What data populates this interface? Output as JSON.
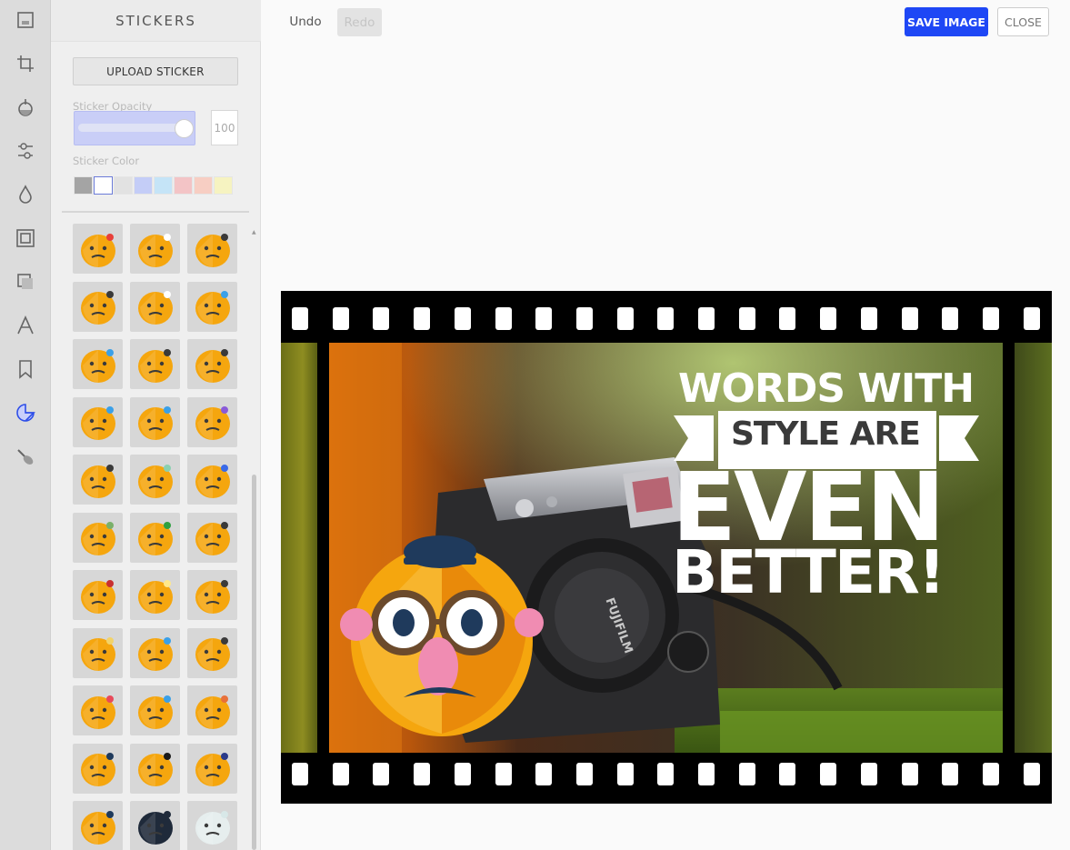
{
  "panel": {
    "title": "STICKERS",
    "upload_label": "UPLOAD STICKER",
    "opacity_label": "Sticker Opacity",
    "opacity_value": "100",
    "opacity_fraction": 1.0,
    "color_label": "Sticker Color",
    "swatches": [
      "#a4a4a4",
      "#ffffff",
      "#e2e2e2",
      "#c4cdf7",
      "#c5e4f7",
      "#f3c4c6",
      "#f7cec3",
      "#f6f3c1"
    ],
    "selected_swatch": 1,
    "stickers": [
      "angry-steam-face",
      "crying-face",
      "frowning-face",
      "pouting-face",
      "tear-squint-face",
      "loudly-crying-face",
      "sobbing-face",
      "expressionless-face",
      "unamused-face",
      "cold-sweat-face",
      "sad-tear-face",
      "sleeping-face",
      "dizzy-face",
      "thinking-face",
      "confused-face",
      "nauseated-face",
      "vomiting-face",
      "grimacing-face",
      "boxing-face",
      "idea-face",
      "blowing-face",
      "beer-face",
      "skateboard-face",
      "guitar-face",
      "headphones-face",
      "swimsuit-face",
      "flower-face",
      "glasses-mustache-face",
      "sunglasses-face",
      "elvis-face",
      "businessman-face",
      "cat-mask-face",
      "skull-face"
    ]
  },
  "toolbar": {
    "undo_label": "Undo",
    "redo_label": "Redo",
    "save_label": "SAVE IMAGE",
    "close_label": "CLOSE"
  },
  "rail": {
    "tools": [
      "frame-icon",
      "crop-icon",
      "filter-icon",
      "adjust-icon",
      "blur-icon",
      "frame-border-icon",
      "shape-icon",
      "text-icon",
      "bookmark-icon",
      "sticker-icon",
      "brush-icon"
    ],
    "active_tool": "sticker-icon"
  },
  "canvas": {
    "overlay_lines": [
      "WORDS WITH",
      "STYLE ARE",
      "EVEN",
      "BETTER!"
    ],
    "camera_brand": "FUJIFILM",
    "colors": {
      "accent": "#1e47f5",
      "sticker_orange": "#f5a60e",
      "film": "#000000"
    }
  }
}
